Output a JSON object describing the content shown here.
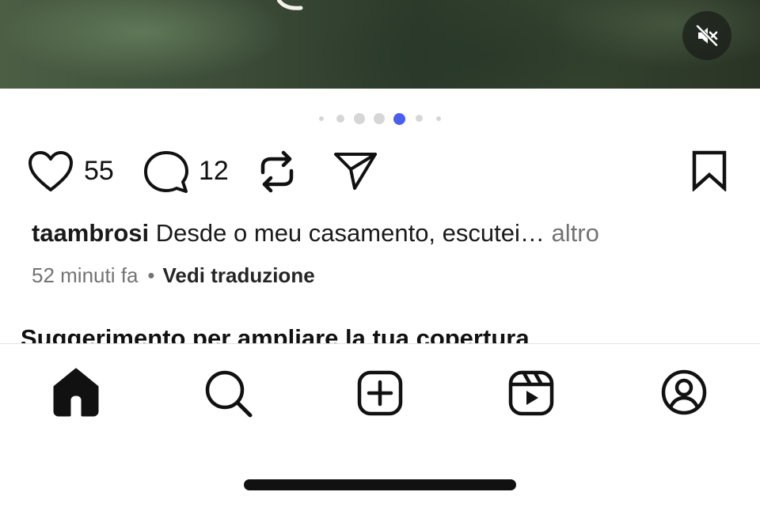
{
  "media": {
    "mute_icon": "speaker-muted-icon",
    "carousel": {
      "total": 7,
      "active_index": 4
    }
  },
  "actions": {
    "like_icon": "heart-icon",
    "likes_count": "55",
    "comment_icon": "comment-bubble-icon",
    "comments_count": "12",
    "repost_icon": "repost-icon",
    "share_icon": "paper-plane-icon",
    "save_icon": "bookmark-icon"
  },
  "caption": {
    "username": "taambrosi",
    "text": "Desde o meu casamento, escutei…",
    "more_label": "altro"
  },
  "meta": {
    "time_ago": "52 minuti fa",
    "separator": "•",
    "translate_label": "Vedi traduzione"
  },
  "suggestion": {
    "title": "Suggerimento per ampliare la tua copertura"
  },
  "tabbar": {
    "items": [
      {
        "name": "home",
        "icon": "home-icon",
        "active": true
      },
      {
        "name": "search",
        "icon": "search-icon",
        "active": false
      },
      {
        "name": "create",
        "icon": "plus-square-icon",
        "active": false
      },
      {
        "name": "reels",
        "icon": "reels-icon",
        "active": false
      },
      {
        "name": "profile",
        "icon": "profile-icon",
        "active": false
      }
    ]
  },
  "colors": {
    "accent_dot": "#4a5ef0",
    "muted_text": "#737373",
    "text": "#111111"
  }
}
